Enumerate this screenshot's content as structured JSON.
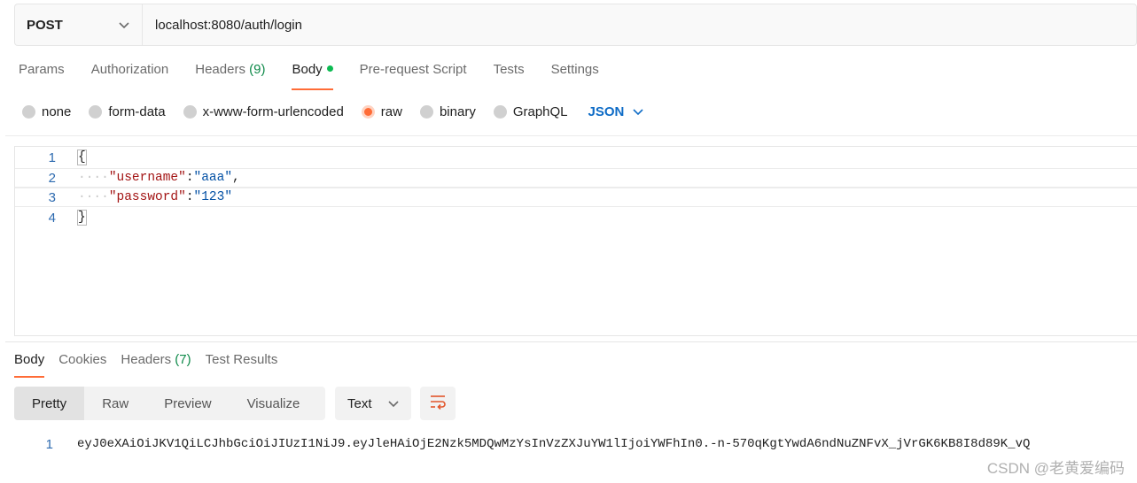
{
  "request": {
    "method": "POST",
    "url": "localhost:8080/auth/login"
  },
  "request_tabs": [
    {
      "label": "Params"
    },
    {
      "label": "Authorization"
    },
    {
      "label": "Headers",
      "count": "(9)"
    },
    {
      "label": "Body"
    },
    {
      "label": "Pre-request Script"
    },
    {
      "label": "Tests"
    },
    {
      "label": "Settings"
    }
  ],
  "body_types": [
    {
      "label": "none",
      "selected": false
    },
    {
      "label": "form-data",
      "selected": false
    },
    {
      "label": "x-www-form-urlencoded",
      "selected": false
    },
    {
      "label": "raw",
      "selected": true
    },
    {
      "label": "binary",
      "selected": false
    },
    {
      "label": "GraphQL",
      "selected": false
    }
  ],
  "raw_format": "JSON",
  "editor": {
    "line_numbers": [
      "1",
      "2",
      "3",
      "4"
    ],
    "open_brace": "{",
    "close_brace": "}",
    "indent_dots": "····",
    "fields": [
      {
        "key": "\"username\"",
        "colon": ":",
        "value": "\"aaa\"",
        "trail": ","
      },
      {
        "key": "\"password\"",
        "colon": ":",
        "value": "\"123\"",
        "trail": ""
      }
    ]
  },
  "response_tabs": [
    {
      "label": "Body"
    },
    {
      "label": "Cookies"
    },
    {
      "label": "Headers",
      "count": "(7)"
    },
    {
      "label": "Test Results"
    }
  ],
  "views": [
    "Pretty",
    "Raw",
    "Preview",
    "Visualize"
  ],
  "format_select": "Text",
  "response_body": {
    "line_number": "1",
    "text": "eyJ0eXAiOiJKV1QiLCJhbGciOiJIUzI1NiJ9.eyJleHAiOjE2Nzk5MDQwMzYsInVzZXJuYW1lIjoiYWFhIn0.-n-570qKgtYwdA6ndNuZNFvX_jVrGK6KB8I8d89K_vQ"
  },
  "watermark": "CSDN @老黄爱编码",
  "colors": {
    "accent": "#ff6c37",
    "count_green": "#0f8a4a",
    "dot_green": "#0cbb52",
    "json_blue": "#0d6bc6",
    "line_number_blue": "#2e6bb0",
    "json_key": "#a31515",
    "json_string": "#0451a5"
  }
}
